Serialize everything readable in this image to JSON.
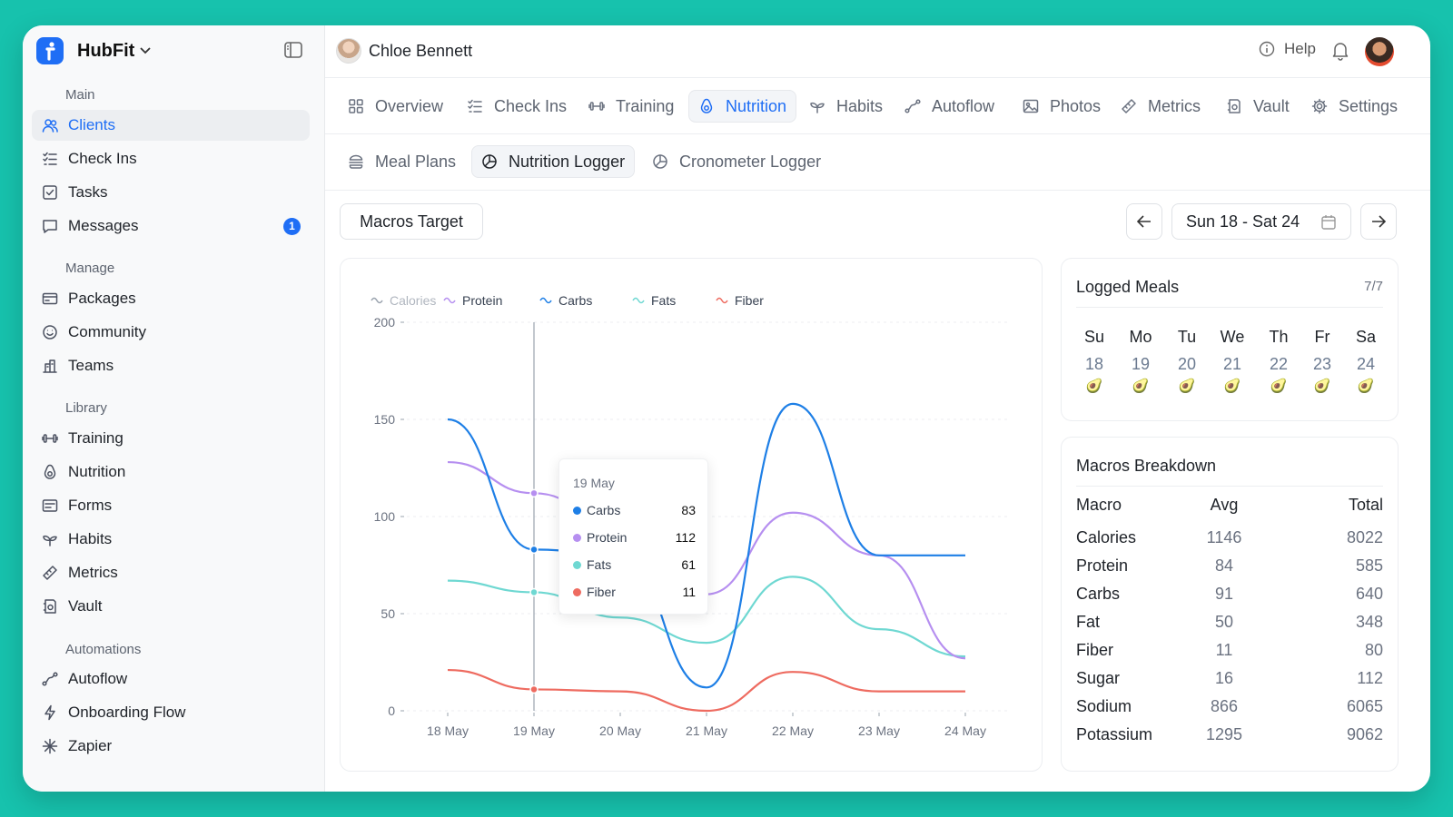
{
  "app": {
    "name": "HubFit"
  },
  "sidebar": {
    "sections": [
      {
        "label": "Main",
        "items": [
          {
            "label": "Clients",
            "icon": "users-icon",
            "active": true
          },
          {
            "label": "Check Ins",
            "icon": "list-check-icon"
          },
          {
            "label": "Tasks",
            "icon": "checkbox-icon"
          },
          {
            "label": "Messages",
            "icon": "message-icon",
            "badge": "1"
          }
        ]
      },
      {
        "label": "Manage",
        "items": [
          {
            "label": "Packages",
            "icon": "card-icon"
          },
          {
            "label": "Community",
            "icon": "smile-icon"
          },
          {
            "label": "Teams",
            "icon": "building-icon"
          }
        ]
      },
      {
        "label": "Library",
        "items": [
          {
            "label": "Training",
            "icon": "dumbbell-icon"
          },
          {
            "label": "Nutrition",
            "icon": "avocado-icon"
          },
          {
            "label": "Forms",
            "icon": "form-icon"
          },
          {
            "label": "Habits",
            "icon": "sprout-icon"
          },
          {
            "label": "Metrics",
            "icon": "ruler-icon"
          },
          {
            "label": "Vault",
            "icon": "vault-icon"
          }
        ]
      },
      {
        "label": "Automations",
        "items": [
          {
            "label": "Autoflow",
            "icon": "autoflow-icon"
          },
          {
            "label": "Onboarding Flow",
            "icon": "bolt-icon"
          },
          {
            "label": "Zapier",
            "icon": "asterisk-icon"
          }
        ]
      }
    ]
  },
  "header": {
    "client_name": "Chloe Bennett",
    "help_label": "Help"
  },
  "tabs": [
    {
      "label": "Overview",
      "icon": "grid-icon"
    },
    {
      "label": "Check Ins",
      "icon": "list-check-icon"
    },
    {
      "label": "Training",
      "icon": "dumbbell-icon"
    },
    {
      "label": "Nutrition",
      "icon": "avocado-icon",
      "active": true
    },
    {
      "label": "Habits",
      "icon": "sprout-icon"
    },
    {
      "label": "Autoflow",
      "icon": "autoflow-icon"
    },
    {
      "label": "Photos",
      "icon": "image-icon"
    },
    {
      "label": "Metrics",
      "icon": "ruler-icon"
    },
    {
      "label": "Vault",
      "icon": "vault-icon"
    },
    {
      "label": "Settings",
      "icon": "gear-icon"
    }
  ],
  "subtabs": [
    {
      "label": "Meal Plans",
      "icon": "burger-icon"
    },
    {
      "label": "Nutrition Logger",
      "icon": "pie-icon",
      "active": true
    },
    {
      "label": "Cronometer Logger",
      "icon": "pie-icon"
    }
  ],
  "toolbar": {
    "macros_target_label": "Macros Target",
    "date_range": "Sun 18 - Sat 24"
  },
  "chart_data": {
    "type": "line",
    "legend": [
      "Calories",
      "Protein",
      "Carbs",
      "Fats",
      "Fiber"
    ],
    "x": [
      "18 May",
      "19 May",
      "20 May",
      "21 May",
      "22 May",
      "23 May",
      "24 May"
    ],
    "ylim": [
      0,
      200
    ],
    "yticks": [
      0,
      50,
      100,
      150,
      200
    ],
    "series": [
      {
        "name": "Calories",
        "color": "#9aa3ae",
        "values": null
      },
      {
        "name": "Protein",
        "color": "#b68ff0",
        "values": [
          128,
          112,
          95,
          60,
          102,
          80,
          27
        ]
      },
      {
        "name": "Carbs",
        "color": "#1e7fe6",
        "values": [
          150,
          83,
          80,
          12,
          158,
          80,
          80
        ]
      },
      {
        "name": "Fats",
        "color": "#6fd8d2",
        "values": [
          67,
          61,
          48,
          35,
          69,
          42,
          28
        ]
      },
      {
        "name": "Fiber",
        "color": "#ee6b60",
        "values": [
          21,
          11,
          10,
          0,
          20,
          10,
          10
        ]
      }
    ],
    "tooltip": {
      "date": "19 May",
      "rows": [
        {
          "name": "Carbs",
          "value": "83",
          "color": "#1e7fe6"
        },
        {
          "name": "Protein",
          "value": "112",
          "color": "#b68ff0"
        },
        {
          "name": "Fats",
          "value": "61",
          "color": "#6fd8d2"
        },
        {
          "name": "Fiber",
          "value": "11",
          "color": "#ee6b60"
        }
      ]
    }
  },
  "logged_meals": {
    "title": "Logged Meals",
    "count": "7/7",
    "days": [
      {
        "name": "Su",
        "num": "18"
      },
      {
        "name": "Mo",
        "num": "19"
      },
      {
        "name": "Tu",
        "num": "20"
      },
      {
        "name": "We",
        "num": "21"
      },
      {
        "name": "Th",
        "num": "22"
      },
      {
        "name": "Fr",
        "num": "23"
      },
      {
        "name": "Sa",
        "num": "24"
      }
    ],
    "day_icon": "🥑"
  },
  "macros_breakdown": {
    "title": "Macros Breakdown",
    "headers": [
      "Macro",
      "Avg",
      "Total"
    ],
    "rows": [
      [
        "Calories",
        "1146",
        "8022"
      ],
      [
        "Protein",
        "84",
        "585"
      ],
      [
        "Carbs",
        "91",
        "640"
      ],
      [
        "Fat",
        "50",
        "348"
      ],
      [
        "Fiber",
        "11",
        "80"
      ],
      [
        "Sugar",
        "16",
        "112"
      ],
      [
        "Sodium",
        "866",
        "6065"
      ],
      [
        "Potassium",
        "1295",
        "9062"
      ]
    ]
  },
  "colors": {
    "accent": "#1f6ef5",
    "background": "#17c2ad"
  }
}
